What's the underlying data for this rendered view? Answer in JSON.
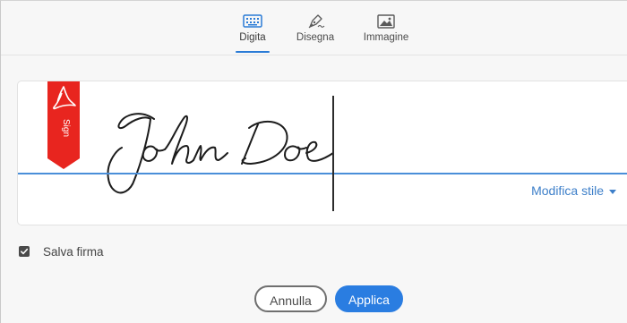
{
  "tabs": [
    {
      "label": "Digita",
      "icon": "keyboard-icon",
      "active": true
    },
    {
      "label": "Disegna",
      "icon": "pen-draw-icon",
      "active": false
    },
    {
      "label": "Immagine",
      "icon": "image-icon",
      "active": false
    }
  ],
  "signature": {
    "text": "John Doe",
    "sign_tag_label": "Sign",
    "sign_tag_color": "#e8251f"
  },
  "style_link": {
    "label": "Modifica stile"
  },
  "save_signature": {
    "label": "Salva firma",
    "checked": true
  },
  "buttons": {
    "cancel_label": "Annulla",
    "apply_label": "Applica"
  },
  "colors": {
    "accent": "#2a7de1",
    "baseline": "#4a8fd9"
  }
}
